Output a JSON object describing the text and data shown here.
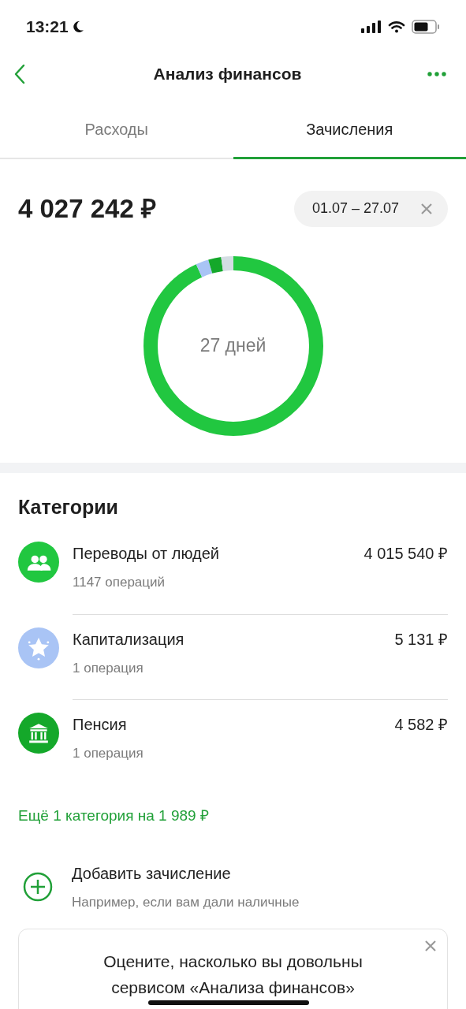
{
  "status_bar": {
    "time": "13:21"
  },
  "header": {
    "title": "Анализ финансов"
  },
  "tabs": [
    {
      "label": "Расходы",
      "selected": false
    },
    {
      "label": "Зачисления",
      "selected": true
    }
  ],
  "summary": {
    "total": "4 027 242 ₽",
    "period": "01.07 – 27.07",
    "center_label": "27 дней"
  },
  "categories": {
    "title": "Категории",
    "items": [
      {
        "name": "Переводы от людей",
        "count": "1147 операций",
        "amount": "4 015 540 ₽",
        "kind": "people",
        "color": "#21c740"
      },
      {
        "name": "Капитализация",
        "count": "1 операция",
        "amount": "5 131 ₽",
        "kind": "star",
        "color": "#a9c4f5"
      },
      {
        "name": "Пенсия",
        "count": "1 операция",
        "amount": "4 582 ₽",
        "kind": "bank",
        "color": "#14a82a"
      }
    ],
    "more_link": "Ещё 1 категория на 1 989 ₽"
  },
  "add": {
    "title": "Добавить зачисление",
    "hint": "Например, если вам дали наличные"
  },
  "survey": {
    "text": "Оцените, насколько вы довольны сервисом «Анализа финансов»"
  }
}
